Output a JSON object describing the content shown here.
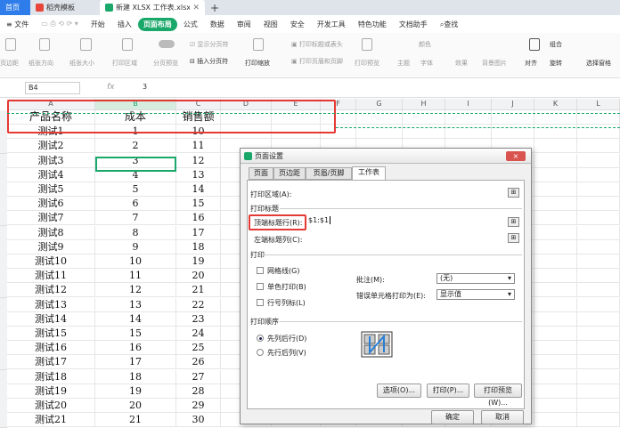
{
  "tabs": {
    "home": "首页",
    "template": "稻壳模板",
    "file": "新建 XLSX 工作表.xlsx",
    "new_tab": "+"
  },
  "menu": [
    "文件",
    "开始",
    "插入",
    "页面布局",
    "公式",
    "数据",
    "审阅",
    "视图",
    "安全",
    "开发工具",
    "特色功能",
    "文档助手",
    "查找"
  ],
  "menu_active": "页面布局",
  "ribbon": {
    "margins": "页边距",
    "orientation": "纸张方向",
    "size": "纸张大小",
    "print_area": "打印区域",
    "page_break_preview": "分页预览",
    "show_page_break": "显示分页符",
    "insert_page_break": "插入分页符",
    "print_scale": "打印缩放",
    "print_titles": "打印标题或表头",
    "print_header_footer": "打印页眉和页脚",
    "print_preview": "打印预览",
    "theme": "主题",
    "font": "字体",
    "color": "颜色",
    "effects": "效果",
    "background": "背景图片",
    "align": "对齐",
    "group": "组合",
    "rotate": "旋转",
    "selection_pane": "选择窗格"
  },
  "formula_bar": {
    "name_box": "B4",
    "fx": "fx",
    "value": "3"
  },
  "columns": [
    "A",
    "B",
    "C",
    "D",
    "E",
    "F",
    "G",
    "H",
    "I",
    "J",
    "K",
    "L"
  ],
  "table": {
    "headers": [
      "产品名称",
      "成本",
      "销售额"
    ],
    "rows": [
      [
        "测试1",
        "1",
        "10"
      ],
      [
        "测试2",
        "2",
        "11"
      ],
      [
        "测试3",
        "3",
        "12"
      ],
      [
        "测试4",
        "4",
        "13"
      ],
      [
        "测试5",
        "5",
        "14"
      ],
      [
        "测试6",
        "6",
        "15"
      ],
      [
        "测试7",
        "7",
        "16"
      ],
      [
        "测试8",
        "8",
        "17"
      ],
      [
        "测试9",
        "9",
        "18"
      ],
      [
        "测试10",
        "10",
        "19"
      ],
      [
        "测试11",
        "11",
        "20"
      ],
      [
        "测试12",
        "12",
        "21"
      ],
      [
        "测试13",
        "13",
        "22"
      ],
      [
        "测试14",
        "14",
        "23"
      ],
      [
        "测试15",
        "15",
        "24"
      ],
      [
        "测试16",
        "16",
        "25"
      ],
      [
        "测试17",
        "17",
        "26"
      ],
      [
        "测试18",
        "18",
        "27"
      ],
      [
        "测试19",
        "19",
        "28"
      ],
      [
        "测试20",
        "20",
        "29"
      ],
      [
        "测试21",
        "21",
        "30"
      ]
    ]
  },
  "dialog": {
    "title": "页面设置",
    "close": "×",
    "tabs": [
      "页面",
      "页边距",
      "页眉/页脚",
      "工作表"
    ],
    "active_tab": "工作表",
    "print_area_label": "打印区域(A):",
    "print_titles_label": "打印标题",
    "rows_to_repeat_label": "顶端标题行(R):",
    "rows_to_repeat_value": "$1:$1",
    "cols_to_repeat_label": "左端标题列(C):",
    "print_section": "打印",
    "gridlines": "网格线(G)",
    "mono": "单色打印(B)",
    "row_col_headers": "行号列标(L)",
    "comments_label": "批注(M):",
    "comments_value": "(无)",
    "errors_label": "错误单元格打印为(E):",
    "errors_value": "显示值",
    "order_section": "打印顺序",
    "down_then_over": "先列后行(D)",
    "over_then_down": "先行后列(V)",
    "options_btn": "选项(O)...",
    "print_btn": "打印(P)...",
    "preview_btn": "打印预览(W)...",
    "ok_btn": "确定",
    "cancel_btn": "取消"
  },
  "colors": {
    "accent": "#1aa86a",
    "highlight": "#e53935",
    "home_tab": "#2f7dea"
  }
}
